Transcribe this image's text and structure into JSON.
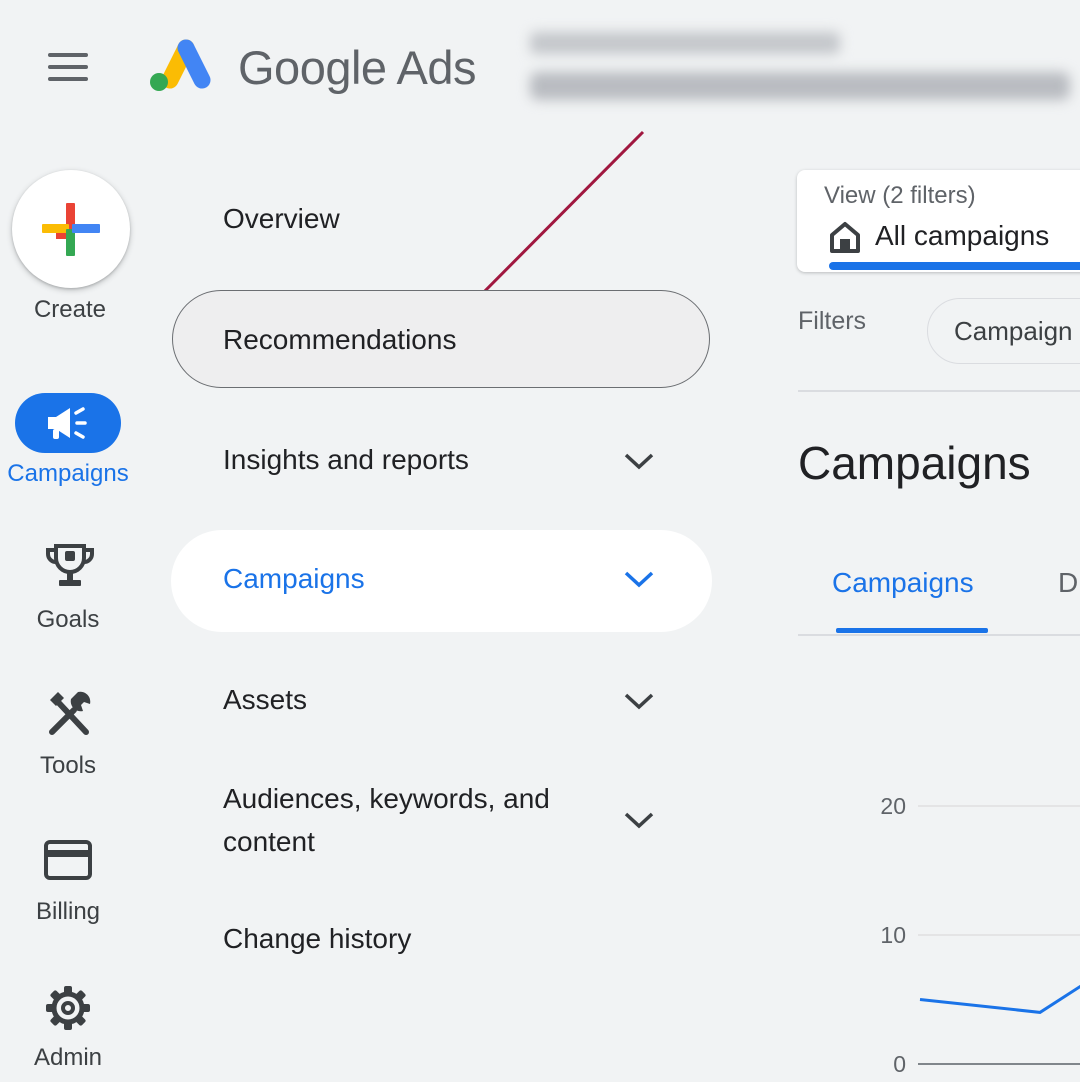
{
  "header": {
    "app_title": "Google Ads",
    "menu_icon": "hamburger-menu-icon"
  },
  "rail": {
    "create_label": "Create",
    "items": [
      {
        "label": "Campaigns",
        "icon": "megaphone-icon",
        "active": true
      },
      {
        "label": "Goals",
        "icon": "trophy-icon"
      },
      {
        "label": "Tools",
        "icon": "tools-icon"
      },
      {
        "label": "Billing",
        "icon": "credit-card-icon"
      },
      {
        "label": "Admin",
        "icon": "gear-icon"
      }
    ]
  },
  "nav": {
    "items": [
      {
        "label": "Overview"
      },
      {
        "label": "Recommendations",
        "highlighted": true
      },
      {
        "label": "Insights and reports",
        "expandable": true
      },
      {
        "label": "Campaigns",
        "expandable": true,
        "active": true
      },
      {
        "label": "Assets",
        "expandable": true
      },
      {
        "label": "Audiences, keywords, and",
        "label_line2": "content",
        "expandable": true
      },
      {
        "label": "Change history"
      }
    ]
  },
  "main": {
    "view": {
      "caption": "View (2 filters)",
      "value": "All campaigns"
    },
    "filters_label": "Filters",
    "filter_chip": "Campaign",
    "page_title": "Campaigns",
    "tabs": [
      {
        "label": "Campaigns",
        "active": true
      },
      {
        "label": "D"
      }
    ]
  },
  "chart_data": {
    "type": "line",
    "y_ticks": [
      "20",
      "10",
      "0"
    ],
    "ylim": [
      0,
      20
    ],
    "series": [
      {
        "values": [
          5,
          4,
          7
        ]
      }
    ]
  },
  "colors": {
    "accent": "#1a73e8",
    "annotation_arrow": "#a0173f",
    "background": "#f1f3f4"
  }
}
